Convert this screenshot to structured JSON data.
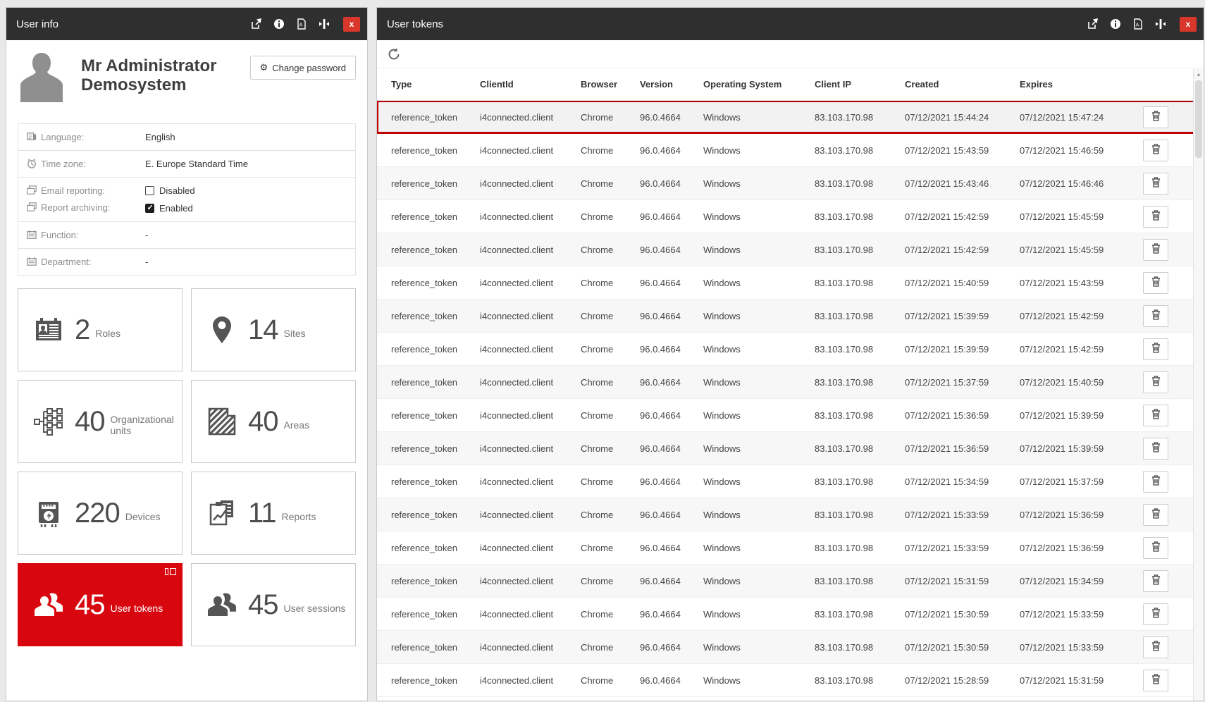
{
  "colors": {
    "accent_red": "#d8070f",
    "header_bg": "#2f2f2f",
    "close_red": "#d9372b",
    "highlight_border": "#bd0000",
    "row_stripe": "#f7f7f7"
  },
  "user_info": {
    "title": "User info",
    "name_line1": "Mr Administrator",
    "name_line2": "Demosystem",
    "change_password_label": "Change password",
    "details": {
      "language": {
        "label": "Language:",
        "value": "English"
      },
      "timezone": {
        "label": "Time zone:",
        "value": "E. Europe Standard Time"
      },
      "email_reporting": {
        "label": "Email reporting:",
        "value": "Disabled",
        "checked": false
      },
      "report_archiving": {
        "label": "Report archiving:",
        "value": "Enabled",
        "checked": true
      },
      "function": {
        "label": "Function:",
        "value": "-"
      },
      "department": {
        "label": "Department:",
        "value": "-"
      }
    },
    "tiles": [
      {
        "count": "2",
        "label": "Roles",
        "icon": "roles-icon",
        "active": false
      },
      {
        "count": "14",
        "label": "Sites",
        "icon": "sites-icon",
        "active": false
      },
      {
        "count": "40",
        "label": "Organizational units",
        "icon": "org-units-icon",
        "active": false
      },
      {
        "count": "40",
        "label": "Areas",
        "icon": "areas-icon",
        "active": false
      },
      {
        "count": "220",
        "label": "Devices",
        "icon": "devices-icon",
        "active": false
      },
      {
        "count": "11",
        "label": "Reports",
        "icon": "reports-icon",
        "active": false
      },
      {
        "count": "45",
        "label": "User tokens",
        "icon": "user-tokens-icon",
        "active": true
      },
      {
        "count": "45",
        "label": "User sessions",
        "icon": "user-sessions-icon",
        "active": false
      }
    ]
  },
  "user_tokens": {
    "title": "User tokens",
    "columns": [
      "Type",
      "ClientId",
      "Browser",
      "Version",
      "Operating System",
      "Client IP",
      "Created",
      "Expires"
    ],
    "rows": [
      {
        "type": "reference_token",
        "client_id": "i4connected.client",
        "browser": "Chrome",
        "version": "96.0.4664",
        "os": "Windows",
        "client_ip": "83.103.170.98",
        "created": "07/12/2021 15:44:24",
        "expires": "07/12/2021 15:47:24",
        "selected": true
      },
      {
        "type": "reference_token",
        "client_id": "i4connected.client",
        "browser": "Chrome",
        "version": "96.0.4664",
        "os": "Windows",
        "client_ip": "83.103.170.98",
        "created": "07/12/2021 15:43:59",
        "expires": "07/12/2021 15:46:59",
        "selected": false
      },
      {
        "type": "reference_token",
        "client_id": "i4connected.client",
        "browser": "Chrome",
        "version": "96.0.4664",
        "os": "Windows",
        "client_ip": "83.103.170.98",
        "created": "07/12/2021 15:43:46",
        "expires": "07/12/2021 15:46:46",
        "selected": false
      },
      {
        "type": "reference_token",
        "client_id": "i4connected.client",
        "browser": "Chrome",
        "version": "96.0.4664",
        "os": "Windows",
        "client_ip": "83.103.170.98",
        "created": "07/12/2021 15:42:59",
        "expires": "07/12/2021 15:45:59",
        "selected": false
      },
      {
        "type": "reference_token",
        "client_id": "i4connected.client",
        "browser": "Chrome",
        "version": "96.0.4664",
        "os": "Windows",
        "client_ip": "83.103.170.98",
        "created": "07/12/2021 15:42:59",
        "expires": "07/12/2021 15:45:59",
        "selected": false
      },
      {
        "type": "reference_token",
        "client_id": "i4connected.client",
        "browser": "Chrome",
        "version": "96.0.4664",
        "os": "Windows",
        "client_ip": "83.103.170.98",
        "created": "07/12/2021 15:40:59",
        "expires": "07/12/2021 15:43:59",
        "selected": false
      },
      {
        "type": "reference_token",
        "client_id": "i4connected.client",
        "browser": "Chrome",
        "version": "96.0.4664",
        "os": "Windows",
        "client_ip": "83.103.170.98",
        "created": "07/12/2021 15:39:59",
        "expires": "07/12/2021 15:42:59",
        "selected": false
      },
      {
        "type": "reference_token",
        "client_id": "i4connected.client",
        "browser": "Chrome",
        "version": "96.0.4664",
        "os": "Windows",
        "client_ip": "83.103.170.98",
        "created": "07/12/2021 15:39:59",
        "expires": "07/12/2021 15:42:59",
        "selected": false
      },
      {
        "type": "reference_token",
        "client_id": "i4connected.client",
        "browser": "Chrome",
        "version": "96.0.4664",
        "os": "Windows",
        "client_ip": "83.103.170.98",
        "created": "07/12/2021 15:37:59",
        "expires": "07/12/2021 15:40:59",
        "selected": false
      },
      {
        "type": "reference_token",
        "client_id": "i4connected.client",
        "browser": "Chrome",
        "version": "96.0.4664",
        "os": "Windows",
        "client_ip": "83.103.170.98",
        "created": "07/12/2021 15:36:59",
        "expires": "07/12/2021 15:39:59",
        "selected": false
      },
      {
        "type": "reference_token",
        "client_id": "i4connected.client",
        "browser": "Chrome",
        "version": "96.0.4664",
        "os": "Windows",
        "client_ip": "83.103.170.98",
        "created": "07/12/2021 15:36:59",
        "expires": "07/12/2021 15:39:59",
        "selected": false
      },
      {
        "type": "reference_token",
        "client_id": "i4connected.client",
        "browser": "Chrome",
        "version": "96.0.4664",
        "os": "Windows",
        "client_ip": "83.103.170.98",
        "created": "07/12/2021 15:34:59",
        "expires": "07/12/2021 15:37:59",
        "selected": false
      },
      {
        "type": "reference_token",
        "client_id": "i4connected.client",
        "browser": "Chrome",
        "version": "96.0.4664",
        "os": "Windows",
        "client_ip": "83.103.170.98",
        "created": "07/12/2021 15:33:59",
        "expires": "07/12/2021 15:36:59",
        "selected": false
      },
      {
        "type": "reference_token",
        "client_id": "i4connected.client",
        "browser": "Chrome",
        "version": "96.0.4664",
        "os": "Windows",
        "client_ip": "83.103.170.98",
        "created": "07/12/2021 15:33:59",
        "expires": "07/12/2021 15:36:59",
        "selected": false
      },
      {
        "type": "reference_token",
        "client_id": "i4connected.client",
        "browser": "Chrome",
        "version": "96.0.4664",
        "os": "Windows",
        "client_ip": "83.103.170.98",
        "created": "07/12/2021 15:31:59",
        "expires": "07/12/2021 15:34:59",
        "selected": false
      },
      {
        "type": "reference_token",
        "client_id": "i4connected.client",
        "browser": "Chrome",
        "version": "96.0.4664",
        "os": "Windows",
        "client_ip": "83.103.170.98",
        "created": "07/12/2021 15:30:59",
        "expires": "07/12/2021 15:33:59",
        "selected": false
      },
      {
        "type": "reference_token",
        "client_id": "i4connected.client",
        "browser": "Chrome",
        "version": "96.0.4664",
        "os": "Windows",
        "client_ip": "83.103.170.98",
        "created": "07/12/2021 15:30:59",
        "expires": "07/12/2021 15:33:59",
        "selected": false
      },
      {
        "type": "reference_token",
        "client_id": "i4connected.client",
        "browser": "Chrome",
        "version": "96.0.4664",
        "os": "Windows",
        "client_ip": "83.103.170.98",
        "created": "07/12/2021 15:28:59",
        "expires": "07/12/2021 15:31:59",
        "selected": false
      }
    ]
  }
}
